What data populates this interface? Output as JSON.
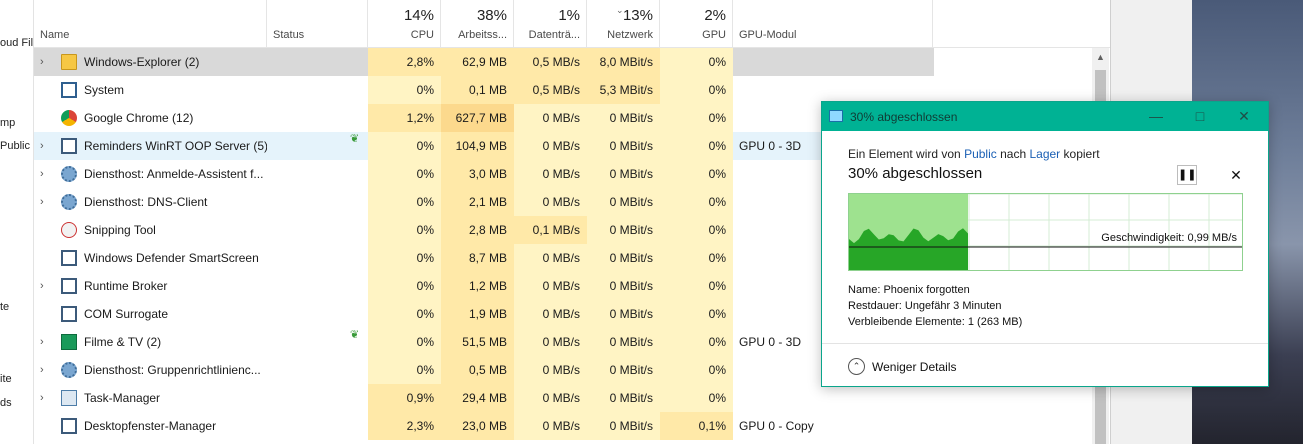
{
  "left_pane": {
    "items": [
      "oud Fil",
      "mp",
      "Public",
      "te",
      "ite",
      "ds"
    ]
  },
  "task_manager": {
    "columns": {
      "name": {
        "label": "Name"
      },
      "status": {
        "label": "Status"
      },
      "cpu": {
        "pct": "14%",
        "label": "CPU"
      },
      "mem": {
        "pct": "38%",
        "label": "Arbeitss..."
      },
      "disk": {
        "pct": "1%",
        "label": "Datenträ..."
      },
      "net": {
        "pct": "13%",
        "label": "Netzwerk"
      },
      "gpu": {
        "pct": "2%",
        "label": "GPU"
      },
      "gpumod": {
        "label": "GPU-Modul"
      }
    },
    "rows": [
      {
        "name": "Windows-Explorer (2)",
        "cpu": "2,8%",
        "mem": "62,9 MB",
        "disk": "0,5 MB/s",
        "net": "8,0 MBit/s",
        "gpu": "0%",
        "gpumod": ""
      },
      {
        "name": "System",
        "cpu": "0%",
        "mem": "0,1 MB",
        "disk": "0,5 MB/s",
        "net": "5,3 MBit/s",
        "gpu": "0%",
        "gpumod": ""
      },
      {
        "name": "Google Chrome (12)",
        "cpu": "1,2%",
        "mem": "627,7 MB",
        "disk": "0 MB/s",
        "net": "0 MBit/s",
        "gpu": "0%",
        "gpumod": ""
      },
      {
        "name": "Reminders WinRT OOP Server (5)",
        "cpu": "0%",
        "mem": "104,9 MB",
        "disk": "0 MB/s",
        "net": "0 MBit/s",
        "gpu": "0%",
        "gpumod": "GPU 0 - 3D"
      },
      {
        "name": "Diensthost: Anmelde-Assistent f...",
        "cpu": "0%",
        "mem": "3,0 MB",
        "disk": "0 MB/s",
        "net": "0 MBit/s",
        "gpu": "0%",
        "gpumod": ""
      },
      {
        "name": "Diensthost: DNS-Client",
        "cpu": "0%",
        "mem": "2,1 MB",
        "disk": "0 MB/s",
        "net": "0 MBit/s",
        "gpu": "0%",
        "gpumod": ""
      },
      {
        "name": "Snipping Tool",
        "cpu": "0%",
        "mem": "2,8 MB",
        "disk": "0,1 MB/s",
        "net": "0 MBit/s",
        "gpu": "0%",
        "gpumod": ""
      },
      {
        "name": "Windows Defender SmartScreen",
        "cpu": "0%",
        "mem": "8,7 MB",
        "disk": "0 MB/s",
        "net": "0 MBit/s",
        "gpu": "0%",
        "gpumod": ""
      },
      {
        "name": "Runtime Broker",
        "cpu": "0%",
        "mem": "1,2 MB",
        "disk": "0 MB/s",
        "net": "0 MBit/s",
        "gpu": "0%",
        "gpumod": ""
      },
      {
        "name": "COM Surrogate",
        "cpu": "0%",
        "mem": "1,9 MB",
        "disk": "0 MB/s",
        "net": "0 MBit/s",
        "gpu": "0%",
        "gpumod": ""
      },
      {
        "name": "Filme & TV (2)",
        "cpu": "0%",
        "mem": "51,5 MB",
        "disk": "0 MB/s",
        "net": "0 MBit/s",
        "gpu": "0%",
        "gpumod": "GPU 0 - 3D"
      },
      {
        "name": "Diensthost: Gruppenrichtlinienc...",
        "cpu": "0%",
        "mem": "0,5 MB",
        "disk": "0 MB/s",
        "net": "0 MBit/s",
        "gpu": "0%",
        "gpumod": ""
      },
      {
        "name": "Task-Manager",
        "cpu": "0,9%",
        "mem": "29,4 MB",
        "disk": "0 MB/s",
        "net": "0 MBit/s",
        "gpu": "0%",
        "gpumod": ""
      },
      {
        "name": "Desktopfenster-Manager",
        "cpu": "2,3%",
        "mem": "23,0 MB",
        "disk": "0 MB/s",
        "net": "0 MBit/s",
        "gpu": "0,1%",
        "gpumod": "GPU 0 - Copy"
      }
    ]
  },
  "copy_dialog": {
    "title": "30% abgeschlossen",
    "line_prefix": "Ein Element wird von",
    "source": "Public",
    "line_mid": "nach",
    "dest": "Lager",
    "line_suffix": "kopiert",
    "status": "30% abgeschlossen",
    "progress": 0.3,
    "speed": "Geschwindigkeit: 0,99 MB/s",
    "name_label": "Name:",
    "name_value": "Phoenix forgotten",
    "remaining_label": "Restdauer:",
    "remaining_value": "Ungefähr 3 Minuten",
    "items_label": "Verbleibende Elemente:",
    "items_value": "1 (263 MB)",
    "less_details": "Weniger Details"
  },
  "colors": {
    "accent": "#00b294",
    "heat_low": "#fff4c4",
    "heat_mid": "#ffe9a8",
    "heat_high": "#fcd98d",
    "selected_row": "#d9d9d9",
    "progress_fill": "#9ee28f",
    "progress_line": "#27a627"
  }
}
